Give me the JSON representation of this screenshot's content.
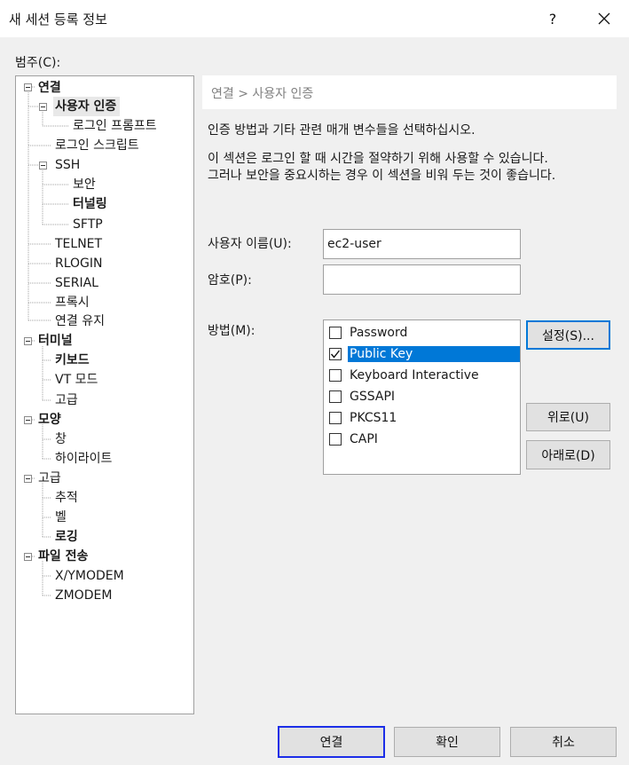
{
  "window": {
    "title": "새 세션 등록 정보",
    "help_label": "?",
    "close_label": "✕"
  },
  "category_label": "범주(C):",
  "tree": {
    "connection": "연결",
    "user_auth": "사용자 인증",
    "login_prompt": "로그인 프롬프트",
    "login_script": "로그인 스크립트",
    "ssh": "SSH",
    "security": "보안",
    "tunneling": "터널링",
    "sftp": "SFTP",
    "telnet": "TELNET",
    "rlogin": "RLOGIN",
    "serial": "SERIAL",
    "proxy": "프록시",
    "keepalive": "연결 유지",
    "terminal": "터미널",
    "keyboard": "키보드",
    "vt_mode": "VT 모드",
    "advanced_term": "고급",
    "appearance": "모양",
    "window": "창",
    "highlight": "하이라이트",
    "advanced": "고급",
    "trace": "추적",
    "bell": "벨",
    "logging": "로깅",
    "file_transfer": "파일 전송",
    "xymodem": "X/YMODEM",
    "zmodem": "ZMODEM"
  },
  "main": {
    "breadcrumb": "연결 > 사용자 인증",
    "desc1": "인증 방법과 기타 관련 매개 변수들을 선택하십시오.",
    "desc2_line1": "이 섹션은 로그인 할 때 시간을 절약하기 위해 사용할 수 있습니다.",
    "desc2_line2": "그러나 보안을 중요시하는 경우 이 섹션을 비워 두는 것이 좋습니다.",
    "username_label": "사용자 이름(U):",
    "username_value": "ec2-user",
    "password_label": "암호(P):",
    "password_value": "",
    "method_label": "방법(M):",
    "methods": [
      {
        "label": "Password",
        "checked": false
      },
      {
        "label": "Public Key",
        "checked": true
      },
      {
        "label": "Keyboard Interactive",
        "checked": false
      },
      {
        "label": "GSSAPI",
        "checked": false
      },
      {
        "label": "PKCS11",
        "checked": false
      },
      {
        "label": "CAPI",
        "checked": false
      }
    ],
    "settings_button": "설정(S)...",
    "up_button": "위로(U)",
    "down_button": "아래로(D)"
  },
  "footer": {
    "connect": "연결",
    "ok": "확인",
    "cancel": "취소"
  },
  "colors": {
    "selection": "#0078d7",
    "default_button_border": "#1c2ee8"
  }
}
